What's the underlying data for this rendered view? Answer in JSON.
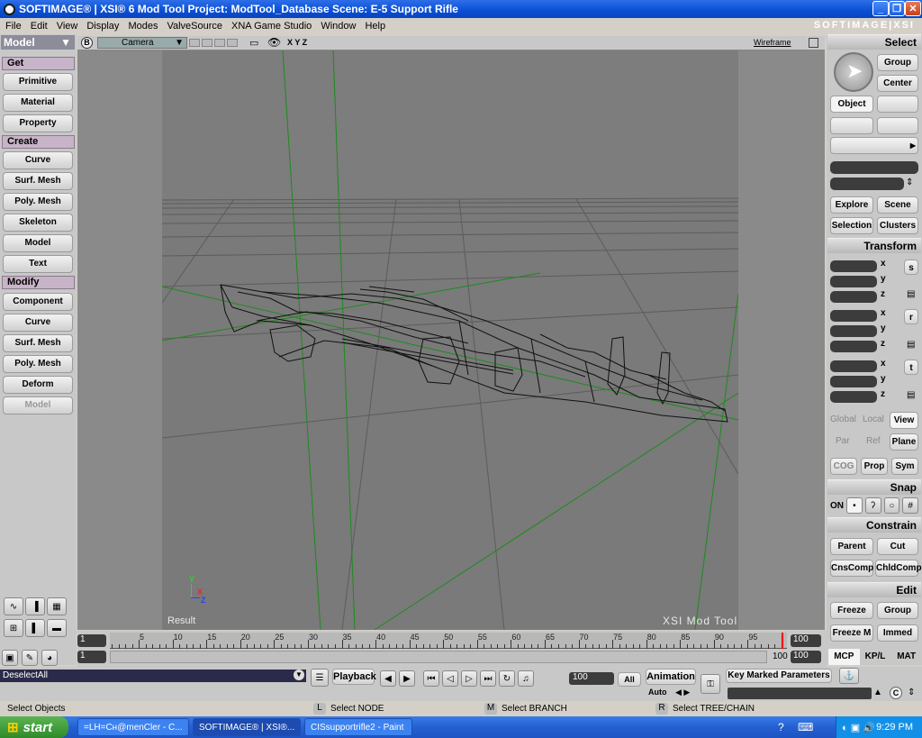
{
  "window": {
    "title": "SOFTIMAGE® | XSI® 6 Mod Tool Project: ModTool_Database    Scene: E-5 Support Rifle",
    "brand": "SOFTIMAGE|XSI"
  },
  "menu": [
    {
      "label": "File"
    },
    {
      "label": "Edit"
    },
    {
      "label": "View"
    },
    {
      "label": "Display"
    },
    {
      "label": "Modes"
    },
    {
      "label": "ValveSource"
    },
    {
      "label": "XNA Game Studio"
    },
    {
      "label": "Window"
    },
    {
      "label": "Help"
    }
  ],
  "left": {
    "mode": "Model",
    "get_header": "Get",
    "get": [
      "Primitive",
      "Material",
      "Property"
    ],
    "create_header": "Create",
    "create": [
      "Curve",
      "Surf. Mesh",
      "Poly. Mesh",
      "Skeleton",
      "Model",
      "Text"
    ],
    "modify_header": "Modify",
    "modify": [
      "Component",
      "Curve",
      "Surf. Mesh",
      "Poly. Mesh",
      "Deform",
      "Model"
    ]
  },
  "viewport": {
    "camera": "Camera",
    "axes": "X Y Z",
    "mode": "Wireframe",
    "result_label": "Result",
    "watermark": "XSI Mod Tool",
    "axis_x": "X",
    "axis_y": "Y",
    "axis_z": "Z",
    "b_label": "B"
  },
  "right": {
    "select_header": "Select",
    "group": "Group",
    "center": "Center",
    "object": "Object",
    "explore": "Explore",
    "scene": "Scene",
    "selection": "Selection",
    "clusters": "Clusters",
    "transform_header": "Transform",
    "axis_x": "x",
    "axis_y": "y",
    "axis_z": "z",
    "s": "s",
    "r": "r",
    "t": "t",
    "global": "Global",
    "local": "Local",
    "view": "View",
    "par": "Par",
    "ref": "Ref",
    "plane": "Plane",
    "cog": "COG",
    "prop": "Prop",
    "sym": "Sym",
    "snap_header": "Snap",
    "on": "ON",
    "constrain_header": "Constrain",
    "parent": "Parent",
    "cut": "Cut",
    "cnscomp": "CnsComp",
    "chldcomp": "ChldComp",
    "edit_header": "Edit",
    "freeze": "Freeze",
    "group2": "Group",
    "freezem": "Freeze M",
    "immed": "Immed",
    "tabs": [
      "MCP",
      "KP/L",
      "MAT"
    ]
  },
  "timeline": {
    "start": "1",
    "start2": "1",
    "end": "100",
    "end2": "100",
    "end3": "100",
    "ticks": [
      "5",
      "10",
      "15",
      "20",
      "25",
      "30",
      "35",
      "40",
      "45",
      "50",
      "55",
      "60",
      "65",
      "70",
      "75",
      "80",
      "85",
      "90",
      "95"
    ],
    "current_frame_marker": "1"
  },
  "playback": {
    "command": "DeselectAll",
    "playback": "Playback",
    "frame": "100",
    "all": "All",
    "animation": "Animation",
    "auto": "Auto",
    "key_marked": "Key Marked Parameters"
  },
  "status": {
    "left": "Select Objects",
    "l_key": "L",
    "l_text": "Select NODE",
    "m_key": "M",
    "m_text": "Select BRANCH",
    "r_key": "R",
    "r_text": "Select TREE/CHAIN"
  },
  "taskbar": {
    "start": "start",
    "tasks": [
      {
        "label": "=LH=Cн@menCler - C..."
      },
      {
        "label": "SOFTIMAGE® | XSI®..."
      },
      {
        "label": "CISsupportrifle2 - Paint"
      }
    ],
    "clock": "9:29 PM"
  }
}
